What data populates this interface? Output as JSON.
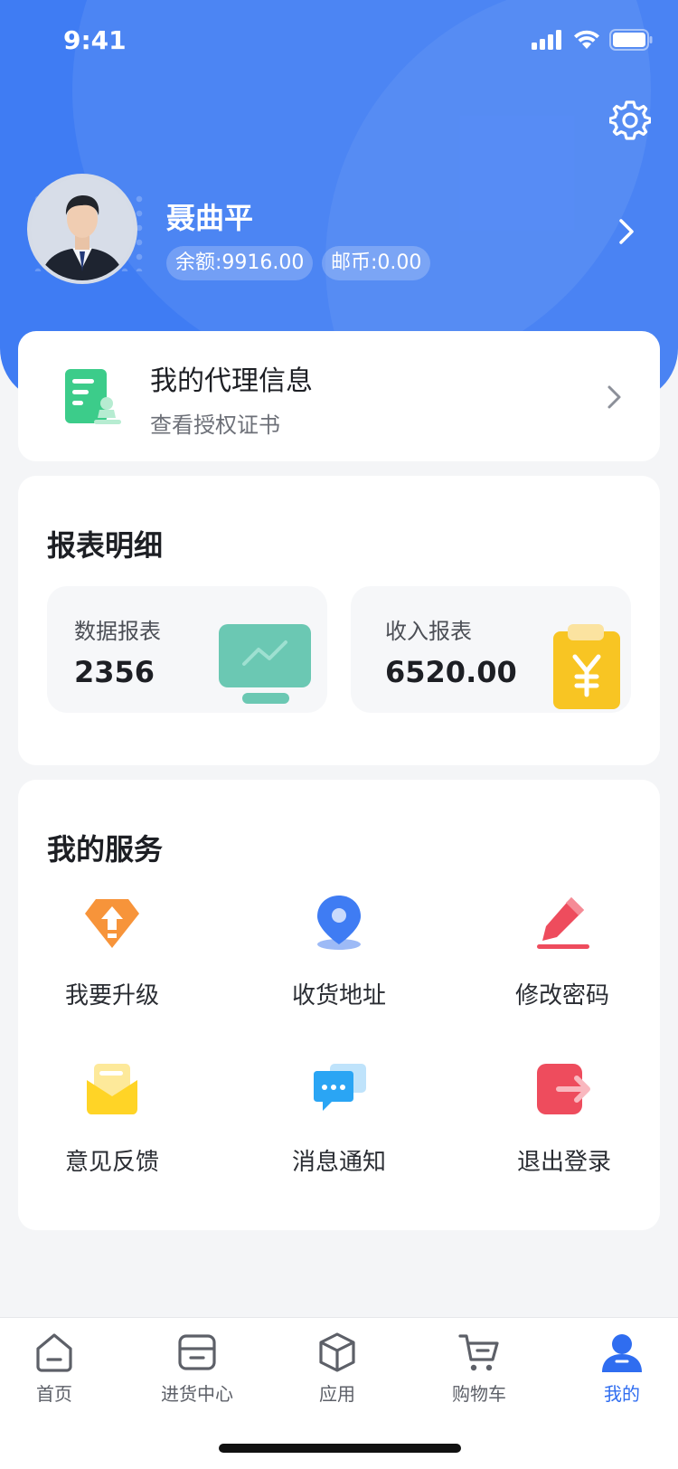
{
  "status_bar": {
    "time": "9:41"
  },
  "profile": {
    "name": "聂曲平",
    "balance": "余额:9916.00",
    "coins": "邮币:0.00"
  },
  "agent_card": {
    "title": "我的代理信息",
    "subtitle": "查看授权证书"
  },
  "reports": {
    "section_title": "报表明细",
    "items": [
      {
        "label": "数据报表",
        "value": "2356",
        "icon": "monitor-chart-icon",
        "color": "#5ec4b0"
      },
      {
        "label": "收入报表",
        "value": "6520.00",
        "icon": "yen-clipboard-icon",
        "color": "#f5c22b"
      }
    ]
  },
  "services": {
    "section_title": "我的服务",
    "items": [
      {
        "label": "我要升级",
        "icon": "upgrade-diamond-icon",
        "color": "#f7943a"
      },
      {
        "label": "收货地址",
        "icon": "location-pin-icon",
        "color": "#3f7cf3"
      },
      {
        "label": "修改密码",
        "icon": "edit-pencil-icon",
        "color": "#ee4c5d"
      },
      {
        "label": "意见反馈",
        "icon": "feedback-envelope-icon",
        "color": "#ffd426"
      },
      {
        "label": "消息通知",
        "icon": "message-bubble-icon",
        "color": "#2aa5f4"
      },
      {
        "label": "退出登录",
        "icon": "logout-icon",
        "color": "#ee4c5d"
      }
    ]
  },
  "tabbar": {
    "items": [
      {
        "label": "首页",
        "icon": "home-icon"
      },
      {
        "label": "进货中心",
        "icon": "purchase-card-icon"
      },
      {
        "label": "应用",
        "icon": "box-icon"
      },
      {
        "label": "购物车",
        "icon": "cart-icon"
      },
      {
        "label": "我的",
        "icon": "user-icon",
        "active": true
      }
    ]
  },
  "colors": {
    "brand": "#3f7cf3",
    "active_tab": "#2f6df0",
    "background": "#f4f5f7"
  }
}
